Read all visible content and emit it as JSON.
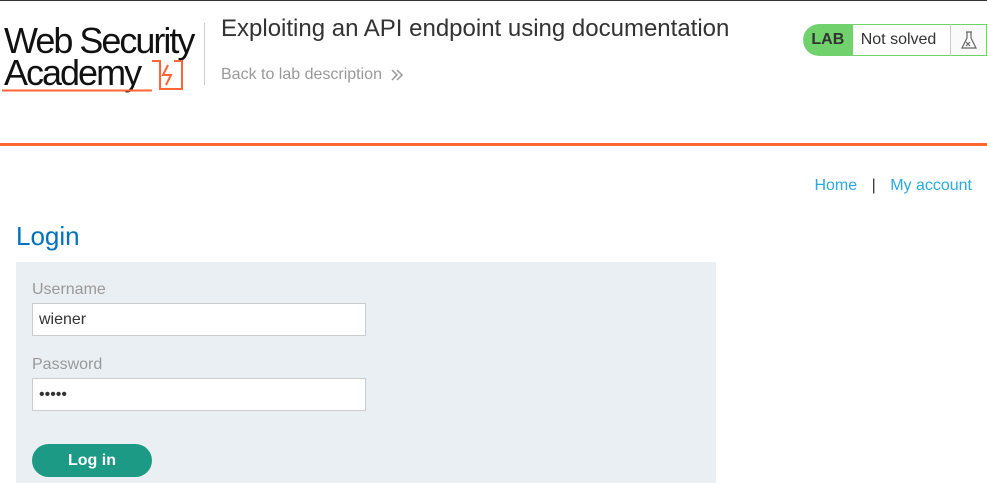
{
  "header": {
    "logo_line1": "Web Security",
    "logo_line2": "Academy",
    "lab_title": "Exploiting an API endpoint using documentation",
    "back_link": "Back to lab description",
    "status": {
      "lab_label": "LAB",
      "state": "Not solved",
      "icon": "flask-icon"
    }
  },
  "nav": {
    "home": "Home",
    "separator": "|",
    "my_account": "My account"
  },
  "page": {
    "title": "Login"
  },
  "form": {
    "username_label": "Username",
    "username_value": "wiener",
    "password_label": "Password",
    "password_value": "peter",
    "submit_label": "Log in"
  },
  "colors": {
    "accent_orange": "#ff6633",
    "lab_green": "#70d16d",
    "link_blue": "#29a9e0",
    "heading_blue": "#0071bc",
    "button_teal": "#1c9a85",
    "panel_bg": "#e9eff2"
  }
}
